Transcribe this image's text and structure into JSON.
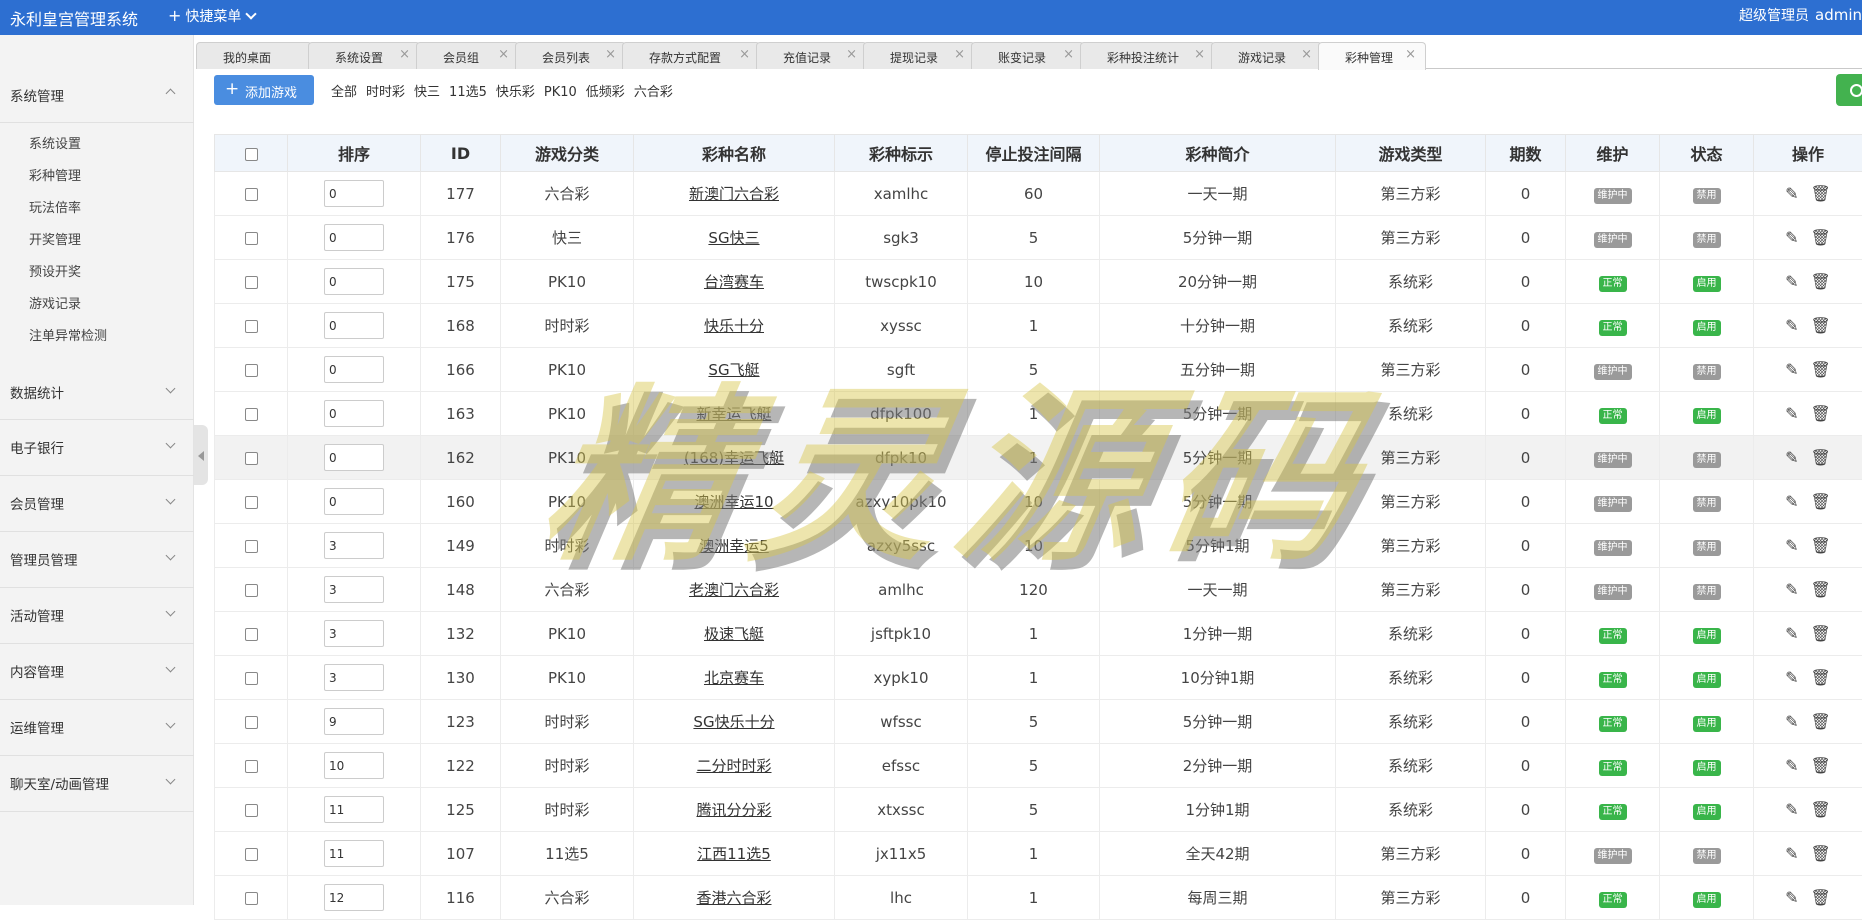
{
  "app": {
    "title": "永利皇宫管理系统",
    "quick_menu": "快捷菜单",
    "role": "超级管理员",
    "user": "admin"
  },
  "sidebar": {
    "groups": [
      {
        "label": "系统管理",
        "expanded": true
      },
      {
        "label": "数据统计"
      },
      {
        "label": "电子银行"
      },
      {
        "label": "会员管理"
      },
      {
        "label": "管理员管理"
      },
      {
        "label": "活动管理"
      },
      {
        "label": "内容管理"
      },
      {
        "label": "运维管理"
      },
      {
        "label": "聊天室/动画管理"
      }
    ],
    "sub_items": [
      "系统设置",
      "彩种管理",
      "玩法倍率",
      "开奖管理",
      "预设开奖",
      "游戏记录",
      "注单异常检测"
    ]
  },
  "tabs": [
    "我的桌面",
    "系统设置",
    "会员组",
    "会员列表",
    "存款方式配置",
    "充值记录",
    "提现记录",
    "账变记录",
    "彩种投注统计",
    "游戏记录",
    "彩种管理"
  ],
  "active_tab": "彩种管理",
  "toolbar": {
    "add_label": "添加游戏",
    "filters": [
      "全部",
      "时时彩",
      "快三",
      "11选5",
      "快乐彩",
      "PK10",
      "低频彩",
      "六合彩"
    ]
  },
  "table": {
    "headers": [
      "排序",
      "ID",
      "游戏分类",
      "彩种名称",
      "彩种标示",
      "停止投注间隔",
      "彩种简介",
      "游戏类型",
      "期数",
      "维护",
      "状态",
      "操作"
    ],
    "rows": [
      {
        "sort": "0",
        "id": "177",
        "cat": "六合彩",
        "name": "新澳门六合彩",
        "code": "xamlhc",
        "interval": "60",
        "desc": "一天一期",
        "type": "第三方彩",
        "periods": "0",
        "maint": "维护中",
        "status": "禁用"
      },
      {
        "sort": "0",
        "id": "176",
        "cat": "快三",
        "name": "SG快三",
        "code": "sgk3",
        "interval": "5",
        "desc": "5分钟一期",
        "type": "第三方彩",
        "periods": "0",
        "maint": "维护中",
        "status": "禁用"
      },
      {
        "sort": "0",
        "id": "175",
        "cat": "PK10",
        "name": "台湾赛车",
        "code": "twscpk10",
        "interval": "10",
        "desc": "20分钟一期",
        "type": "系统彩",
        "periods": "0",
        "maint": "正常",
        "status": "启用"
      },
      {
        "sort": "0",
        "id": "168",
        "cat": "时时彩",
        "name": "快乐十分",
        "code": "xyssc",
        "interval": "1",
        "desc": "十分钟一期",
        "type": "系统彩",
        "periods": "0",
        "maint": "正常",
        "status": "启用"
      },
      {
        "sort": "0",
        "id": "166",
        "cat": "PK10",
        "name": "SG飞艇",
        "code": "sgft",
        "interval": "5",
        "desc": "五分钟一期",
        "type": "第三方彩",
        "periods": "0",
        "maint": "维护中",
        "status": "禁用"
      },
      {
        "sort": "0",
        "id": "163",
        "cat": "PK10",
        "name": "新幸运飞艇",
        "code": "dfpk100",
        "interval": "1",
        "desc": "5分钟一期",
        "type": "系统彩",
        "periods": "0",
        "maint": "正常",
        "status": "启用"
      },
      {
        "sort": "0",
        "id": "162",
        "cat": "PK10",
        "name": "(168)幸运飞艇",
        "code": "dfpk10",
        "interval": "1",
        "desc": "5分钟一期",
        "type": "第三方彩",
        "periods": "0",
        "maint": "维护中",
        "status": "禁用"
      },
      {
        "sort": "0",
        "id": "160",
        "cat": "PK10",
        "name": "澳洲幸运10",
        "code": "azxy10pk10",
        "interval": "10",
        "desc": "5分钟一期",
        "type": "第三方彩",
        "periods": "0",
        "maint": "维护中",
        "status": "禁用"
      },
      {
        "sort": "3",
        "id": "149",
        "cat": "时时彩",
        "name": "澳洲幸运5",
        "code": "azxy5ssc",
        "interval": "10",
        "desc": "5分钟1期",
        "type": "第三方彩",
        "periods": "0",
        "maint": "维护中",
        "status": "禁用"
      },
      {
        "sort": "3",
        "id": "148",
        "cat": "六合彩",
        "name": "老澳门六合彩",
        "code": "amlhc",
        "interval": "120",
        "desc": "一天一期",
        "type": "第三方彩",
        "periods": "0",
        "maint": "维护中",
        "status": "禁用"
      },
      {
        "sort": "3",
        "id": "132",
        "cat": "PK10",
        "name": "极速飞艇",
        "code": "jsftpk10",
        "interval": "1",
        "desc": "1分钟一期",
        "type": "系统彩",
        "periods": "0",
        "maint": "正常",
        "status": "启用"
      },
      {
        "sort": "3",
        "id": "130",
        "cat": "PK10",
        "name": "北京赛车",
        "code": "xypk10",
        "interval": "1",
        "desc": "10分钟1期",
        "type": "系统彩",
        "periods": "0",
        "maint": "正常",
        "status": "启用"
      },
      {
        "sort": "9",
        "id": "123",
        "cat": "时时彩",
        "name": "SG快乐十分",
        "code": "wfssc",
        "interval": "5",
        "desc": "5分钟一期",
        "type": "系统彩",
        "periods": "0",
        "maint": "正常",
        "status": "启用"
      },
      {
        "sort": "10",
        "id": "122",
        "cat": "时时彩",
        "name": "二分时时彩",
        "code": "efssc",
        "interval": "5",
        "desc": "2分钟一期",
        "type": "系统彩",
        "periods": "0",
        "maint": "正常",
        "status": "启用"
      },
      {
        "sort": "11",
        "id": "125",
        "cat": "时时彩",
        "name": "腾讯分分彩",
        "code": "xtxssc",
        "interval": "5",
        "desc": "1分钟1期",
        "type": "系统彩",
        "periods": "0",
        "maint": "正常",
        "status": "启用"
      },
      {
        "sort": "11",
        "id": "107",
        "cat": "11选5",
        "name": "江西11选5",
        "code": "jx11x5",
        "interval": "1",
        "desc": "全天42期",
        "type": "第三方彩",
        "periods": "0",
        "maint": "维护中",
        "status": "禁用"
      },
      {
        "sort": "12",
        "id": "116",
        "cat": "六合彩",
        "name": "香港六合彩",
        "code": "lhc",
        "interval": "1",
        "desc": "每周三期",
        "type": "第三方彩",
        "periods": "0",
        "maint": "正常",
        "status": "启用"
      }
    ]
  },
  "watermark": "精灵源码",
  "colors": {
    "topbar": "#2d6fd1",
    "add_button": "#4a8de0",
    "ok_badge": "#39b54a",
    "gray_badge": "#9a9a9a",
    "watermark": "#d8c64a"
  }
}
